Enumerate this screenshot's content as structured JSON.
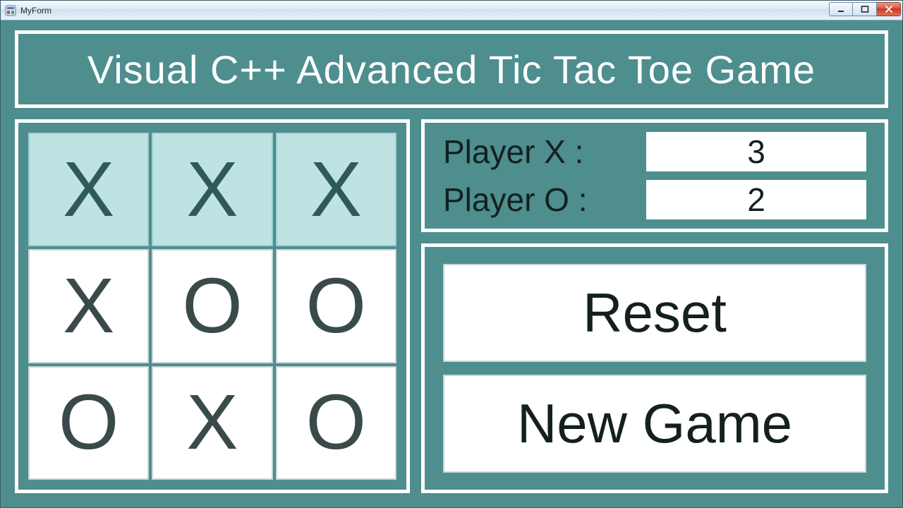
{
  "window": {
    "title": "MyForm",
    "controls": {
      "minimize": "–",
      "maximize": "▢",
      "close": "✕"
    }
  },
  "header": {
    "title": "Visual C++ Advanced Tic Tac Toe Game"
  },
  "board": {
    "cells": [
      "X",
      "X",
      "X",
      "X",
      "O",
      "O",
      "O",
      "X",
      "O"
    ],
    "winning_indices": [
      0,
      1,
      2
    ]
  },
  "score": {
    "player_x_label": "Player X :",
    "player_x_value": "3",
    "player_o_label": "Player O :",
    "player_o_value": "2"
  },
  "buttons": {
    "reset": "Reset",
    "new_game": "New Game"
  },
  "colors": {
    "teal": "#4e8e8e",
    "win_cell": "#bfe3e3",
    "frame": "#ffffff"
  }
}
